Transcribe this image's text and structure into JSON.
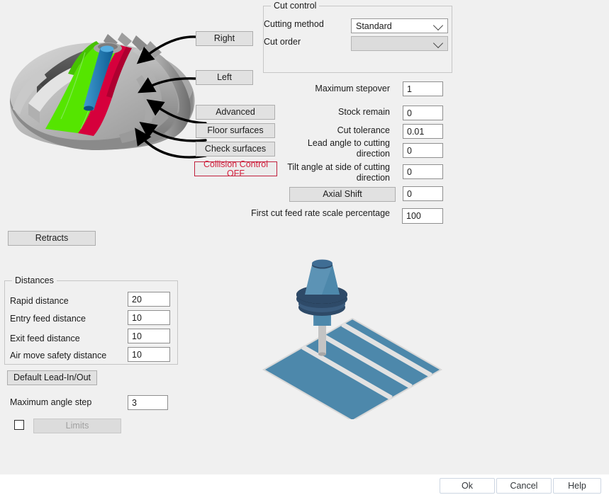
{
  "cut_control": {
    "title": "Cut control",
    "cutting_method": {
      "label": "Cutting method",
      "value": "Standard"
    },
    "cut_order": {
      "label": "Cut order",
      "value": ""
    }
  },
  "params": [
    {
      "label": "Maximum stepover",
      "value": "1"
    },
    {
      "label": "Stock remain",
      "value": "0"
    },
    {
      "label": "Cut tolerance",
      "value": "0.01"
    },
    {
      "label": "Lead angle to cutting\ndirection",
      "value": "0"
    },
    {
      "label": "Tilt angle at side of cutting\ndirection",
      "value": "0"
    },
    {
      "label": "Axial Shift",
      "value": "0"
    },
    {
      "label": "First cut feed rate scale percentage",
      "value": "100"
    }
  ],
  "surface_buttons": {
    "right": "Right",
    "left": "Left",
    "advanced": "Advanced",
    "floor_surfaces": "Floor surfaces",
    "check_surfaces": "Check surfaces",
    "collision_control": "Collision Control OFF"
  },
  "retracts_label": "Retracts",
  "distances": {
    "title": "Distances",
    "rows": [
      {
        "label": "Rapid distance",
        "value": "20"
      },
      {
        "label": "Entry feed distance",
        "value": "10"
      },
      {
        "label": "Exit feed distance",
        "value": "10"
      },
      {
        "label": "Air move safety distance",
        "value": "10"
      }
    ]
  },
  "lead_in_out": {
    "default_button": "Default Lead-In/Out",
    "max_angle_step": {
      "label": "Maximum angle step",
      "value": "3"
    },
    "limits_button": "Limits"
  },
  "dialog_buttons": {
    "ok": "Ok",
    "cancel": "Cancel",
    "help": "Help"
  },
  "colors": {
    "background": "#f0f0f0",
    "alert_red": "#d21f3c",
    "floor_green": "#55e500",
    "blade_red": "#d6003c",
    "tool_blue": "#1a74b0",
    "plane_blue": "#4d88ab",
    "holder_dark": "#2e4a68"
  }
}
